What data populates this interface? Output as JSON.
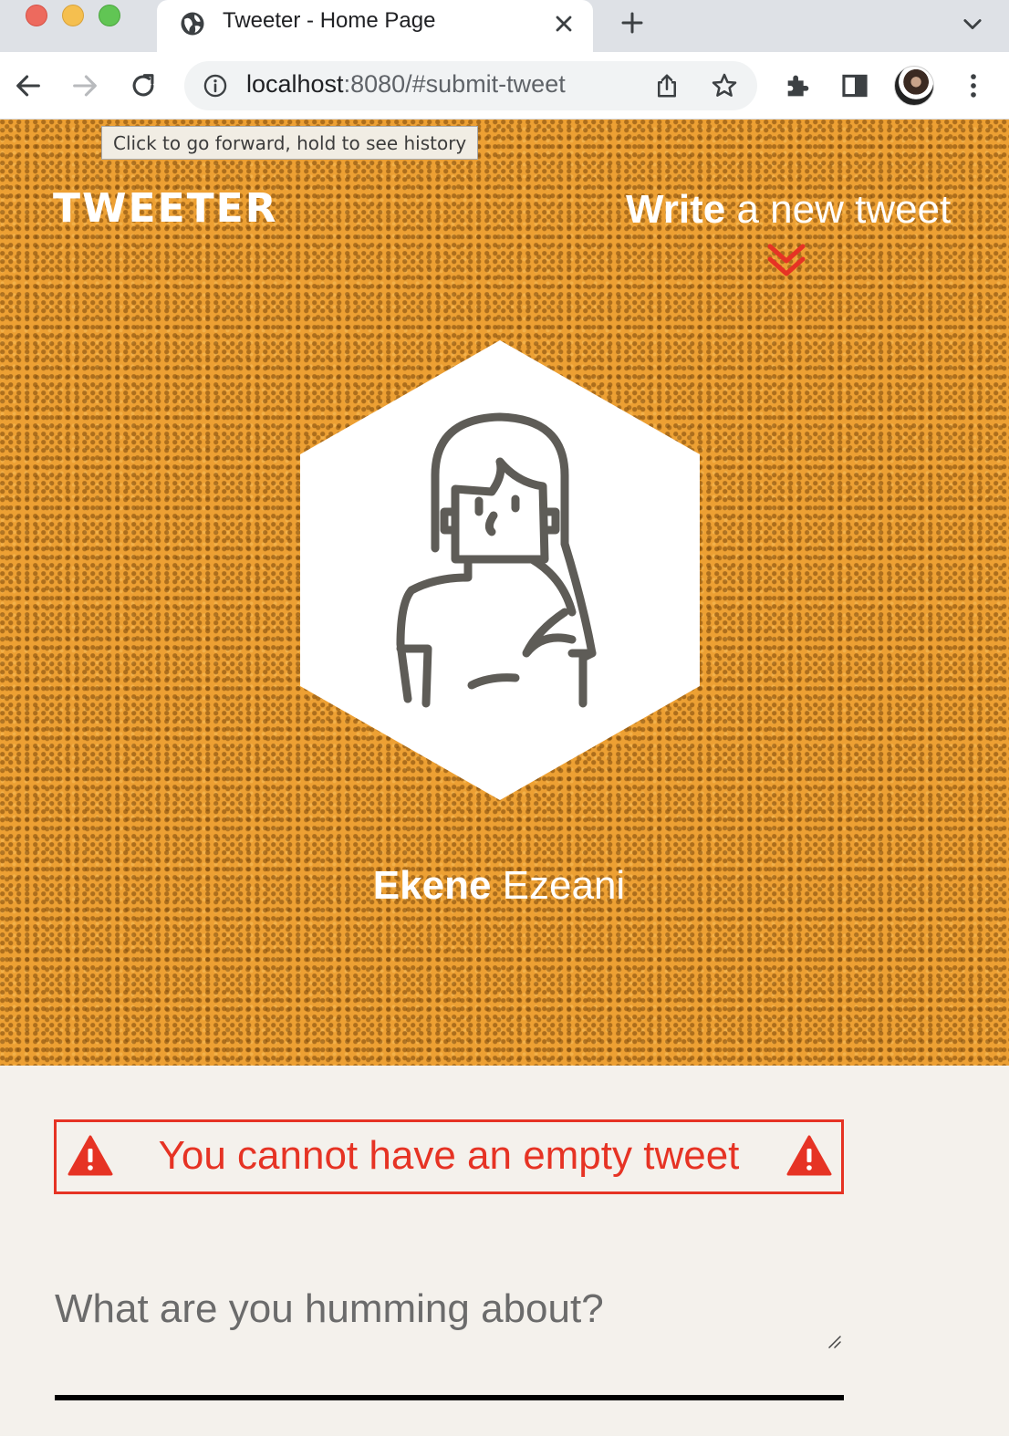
{
  "browser": {
    "tab": {
      "title": "Tweeter - Home Page",
      "favicon": "globe-icon"
    },
    "url": {
      "host": "localhost",
      "rest": ":8080/#submit-tweet"
    },
    "tooltip": "Click to go forward, hold to see history",
    "icons": [
      "back-arrow-icon",
      "forward-arrow-icon",
      "reload-icon",
      "info-icon",
      "share-icon",
      "star-icon",
      "extensions-icon",
      "side-panel-icon",
      "more-vert-icon"
    ]
  },
  "nav": {
    "brand": "TWEETER",
    "compose_bold": "Write",
    "compose_rest": " a new tweet",
    "arrow_icon": "double-chevron-down-icon"
  },
  "profile": {
    "first_name": "Ekene",
    "last_name": " Ezeani",
    "avatar_icon": "woman-avatar-icon"
  },
  "form": {
    "error_message": "You cannot have an empty tweet",
    "placeholder": "What are you humming about?",
    "value": ""
  },
  "colors": {
    "hero_background": "#eda033",
    "accent_red": "#e63324",
    "page_background": "#f4f1ec"
  }
}
